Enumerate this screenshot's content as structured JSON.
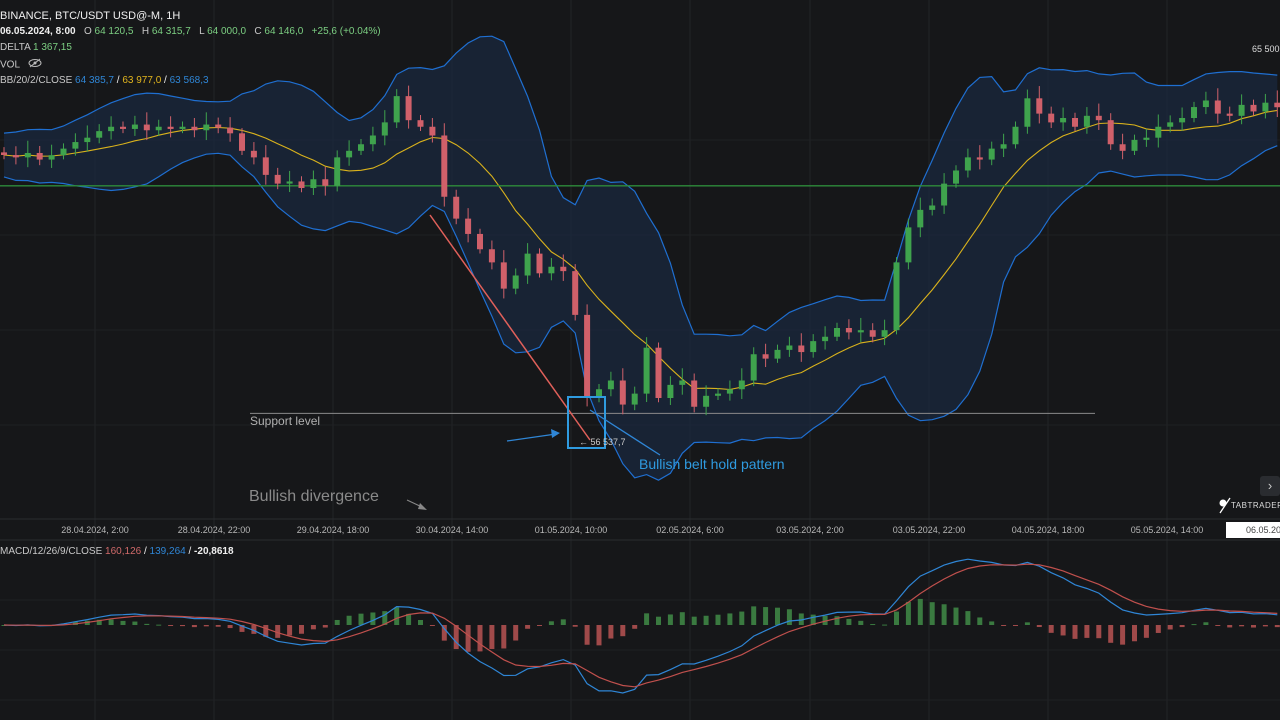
{
  "header": {
    "symbol": "BINANCE, BTC/USDT USD@-M, 1H",
    "datetime": "06.05.2024, 8:00",
    "o_label": "O",
    "o": "64 120,5",
    "h_label": "H",
    "h": "64 315,7",
    "l_label": "L",
    "l": "64 000,0",
    "c_label": "C",
    "c": "64 146,0",
    "change": "+25,6 (+0.04%)",
    "delta_label": "DELTA",
    "delta": "1 367,15",
    "vol_label": "VOL",
    "vol_icon": "eye-off-icon",
    "bb_label": "BB/20/2/CLOSE",
    "bb_upper": "64 385,7",
    "bb_mid": "63 977,0",
    "bb_lower": "63 568,3",
    "sep": "/"
  },
  "price_axis": {
    "label": "65 500"
  },
  "time_axis": {
    "labels": [
      "28.04.2024, 2:00",
      "28.04.2024, 22:00",
      "29.04.2024, 18:00",
      "30.04.2024, 14:00",
      "01.05.2024, 10:00",
      "02.05.2024, 6:00",
      "03.05.2024, 2:00",
      "03.05.2024, 22:00",
      "04.05.2024, 18:00",
      "05.05.2024, 14:00"
    ],
    "current": "06.05.20"
  },
  "macd": {
    "label": "MACD/12/26/9/CLOSE",
    "macd": "160,126",
    "signal": "139,264",
    "hist": "-20,8618"
  },
  "annotations": {
    "support": "Support level",
    "divergence": "Bullish divergence",
    "pattern": "Bullish belt hold pattern",
    "measure": "← 56 537,7"
  },
  "logo": "TABTRADER",
  "colors": {
    "up": "#3fa34d",
    "down": "#d0606a",
    "bb_band": "#1f6fd1",
    "bb_mid": "#d9b21c",
    "level": "#2e8b3a",
    "macd": "#2f86d6",
    "signal": "#c0504d"
  },
  "chart_data": {
    "type": "candlestick",
    "interval": "2H (approx. sampled)",
    "price_axis_label": "65 500",
    "horizontal_level": 62350,
    "support_level": 57150,
    "closes": [
      63054,
      63000,
      63100,
      62950,
      63050,
      63200,
      63350,
      63450,
      63600,
      63700,
      63650,
      63750,
      63620,
      63700,
      63650,
      63700,
      63620,
      63750,
      63680,
      63550,
      63150,
      63000,
      62600,
      62400,
      62450,
      62300,
      62500,
      62350,
      63000,
      63150,
      63300,
      63500,
      63800,
      64400,
      63850,
      63700,
      63500,
      62100,
      61600,
      61250,
      60900,
      60600,
      60000,
      60300,
      60800,
      60350,
      60500,
      60400,
      59400,
      57500,
      57700,
      57900,
      57350,
      57600,
      58650,
      57500,
      57800,
      57900,
      57300,
      57550,
      57600,
      57700,
      57900,
      58500,
      58400,
      58600,
      58700,
      58550,
      58800,
      58900,
      59100,
      59000,
      59050,
      58900,
      59050,
      60600,
      61400,
      61800,
      61900,
      62400,
      62700,
      63000,
      62950,
      63200,
      63300,
      63700,
      64350,
      64000,
      63800,
      63900,
      63700,
      63950,
      63850,
      63300,
      63150,
      63400,
      63450,
      63700,
      63800,
      63900,
      64150,
      64300,
      64000,
      63950,
      64200,
      64050,
      64250,
      64146
    ],
    "indicators": [
      "BB/20/2/CLOSE",
      "MACD/12/26/9/CLOSE"
    ]
  }
}
